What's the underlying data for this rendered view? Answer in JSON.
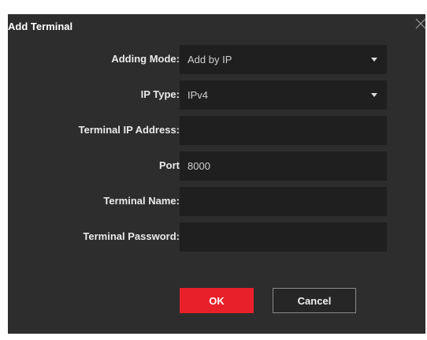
{
  "dialog": {
    "title": "Add Terminal",
    "close_icon": "close-icon"
  },
  "form": {
    "adding_mode": {
      "label": "Adding Mode:",
      "value": "Add by IP",
      "icon": "chevron-down-icon"
    },
    "ip_type": {
      "label": "IP Type:",
      "value": "IPv4",
      "icon": "chevron-down-icon"
    },
    "terminal_ip": {
      "label": "Terminal IP Address:",
      "value": ""
    },
    "port": {
      "label": "Port",
      "value": "8000"
    },
    "terminal_name": {
      "label": "Terminal Name:",
      "value": ""
    },
    "terminal_password": {
      "label": "Terminal Password:",
      "value": ""
    }
  },
  "buttons": {
    "ok_label": "OK",
    "cancel_label": "Cancel"
  },
  "colors": {
    "dialog_bg": "#2d2d2d",
    "field_bg": "#1f1f1f",
    "accent": "#e8202a"
  }
}
